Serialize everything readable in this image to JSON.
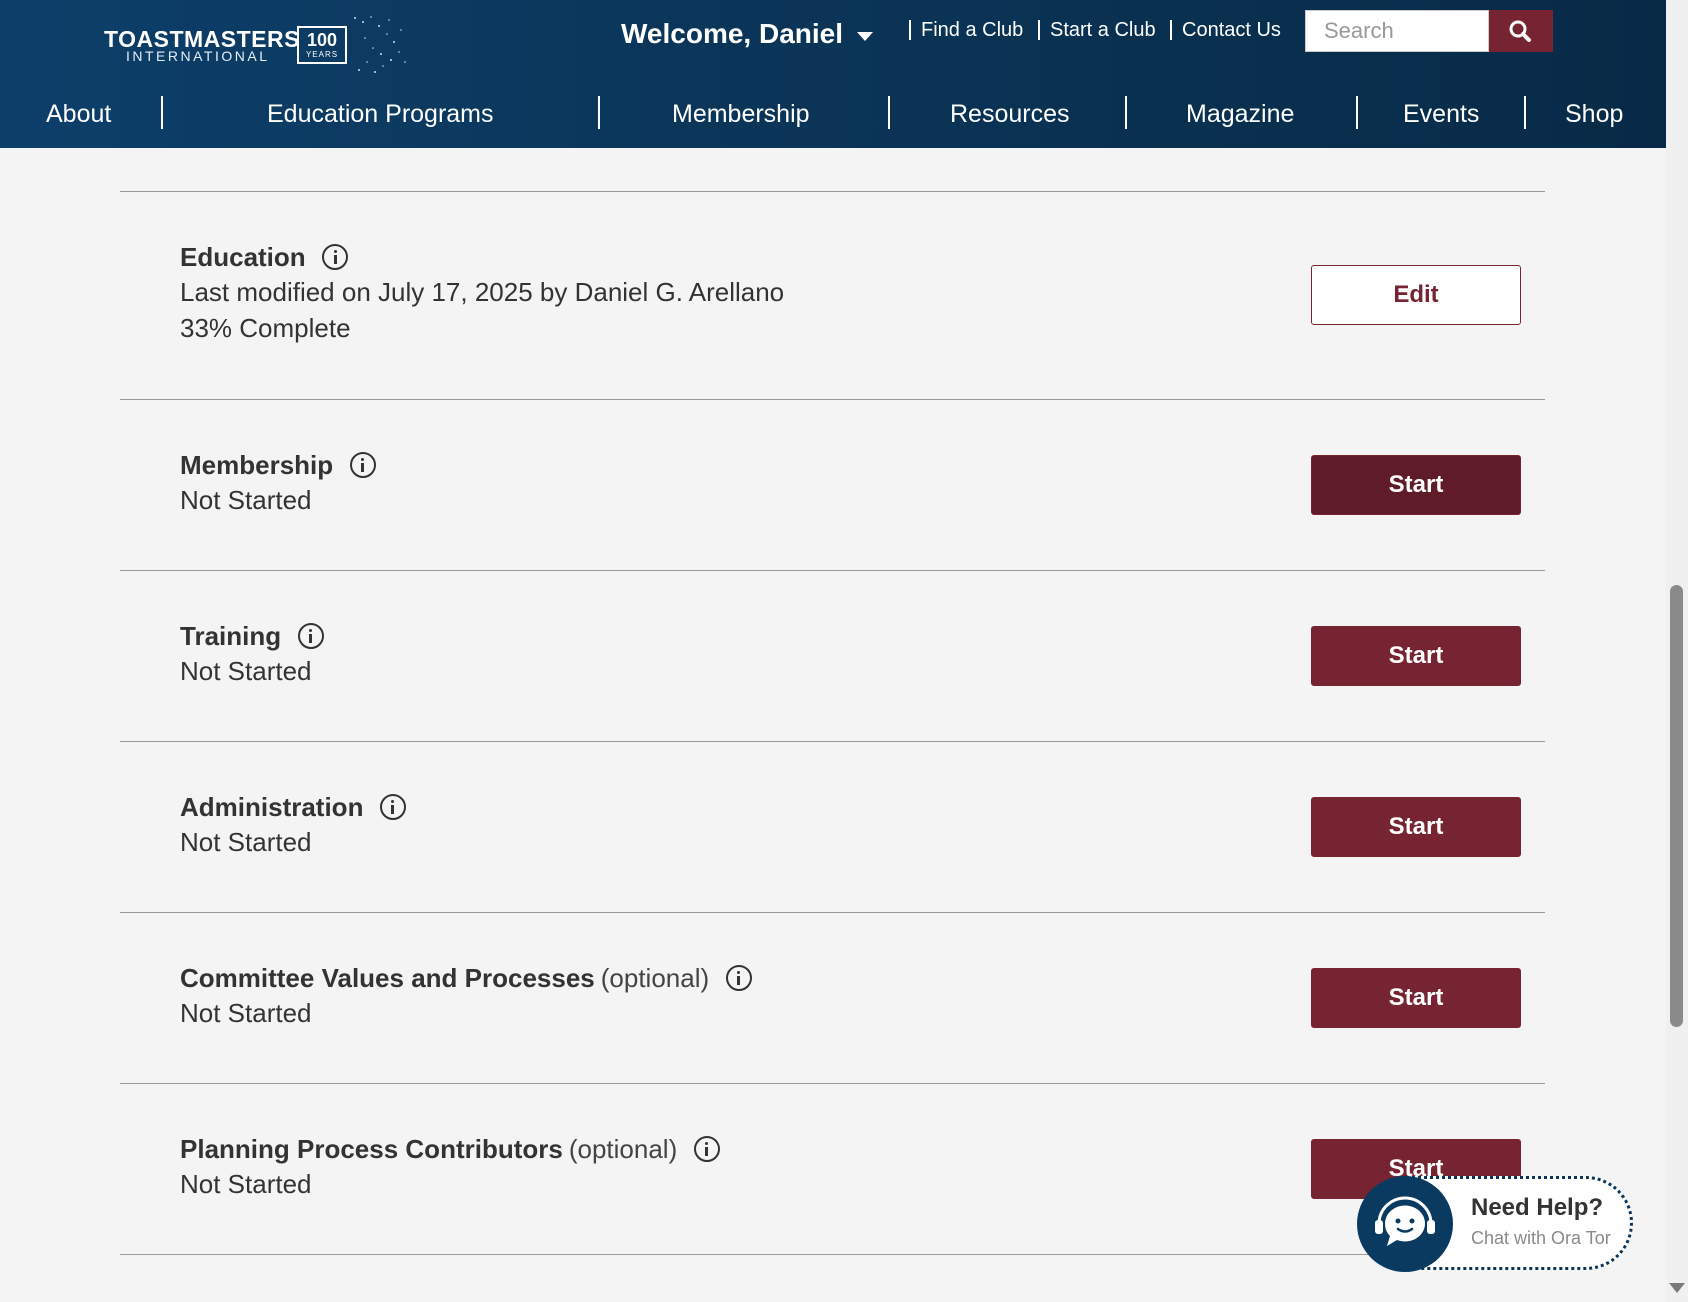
{
  "header": {
    "logo_main": "TOASTMASTERS",
    "logo_sub": "INTERNATIONAL",
    "logo_badge_num": "100",
    "logo_badge_text": "YEARS",
    "welcome": "Welcome, Daniel",
    "utility_links": [
      "Find a Club",
      "Start a Club",
      "Contact Us"
    ],
    "search_placeholder": "Search"
  },
  "nav": [
    "About",
    "Education Programs",
    "Membership",
    "Resources",
    "Magazine",
    "Events",
    "Shop"
  ],
  "sections": [
    {
      "title": "Education",
      "optional": "",
      "lines": [
        "Last modified on July 17, 2025 by Daniel G. Arellano",
        "33% Complete"
      ],
      "button": "Edit"
    },
    {
      "title": "Membership",
      "optional": "",
      "lines": [
        "Not Started"
      ],
      "button": "Start"
    },
    {
      "title": "Training",
      "optional": "",
      "lines": [
        "Not Started"
      ],
      "button": "Start"
    },
    {
      "title": "Administration",
      "optional": "",
      "lines": [
        "Not Started"
      ],
      "button": "Start"
    },
    {
      "title": "Committee Values and Processes",
      "optional": "(optional)",
      "lines": [
        "Not Started"
      ],
      "button": "Start"
    },
    {
      "title": "Planning Process Contributors",
      "optional": "(optional)",
      "lines": [
        "Not Started"
      ],
      "button": "Start"
    }
  ],
  "help": {
    "title": "Need Help?",
    "subtitle": "Chat with Ora Tor"
  },
  "colors": {
    "brand_maroon": "#772432",
    "header_navy": "#0b3558",
    "page_bg": "#f4f4f4"
  },
  "icons": [
    "info-icon",
    "search-icon",
    "chevron-down-icon",
    "chat-bot-icon"
  ]
}
